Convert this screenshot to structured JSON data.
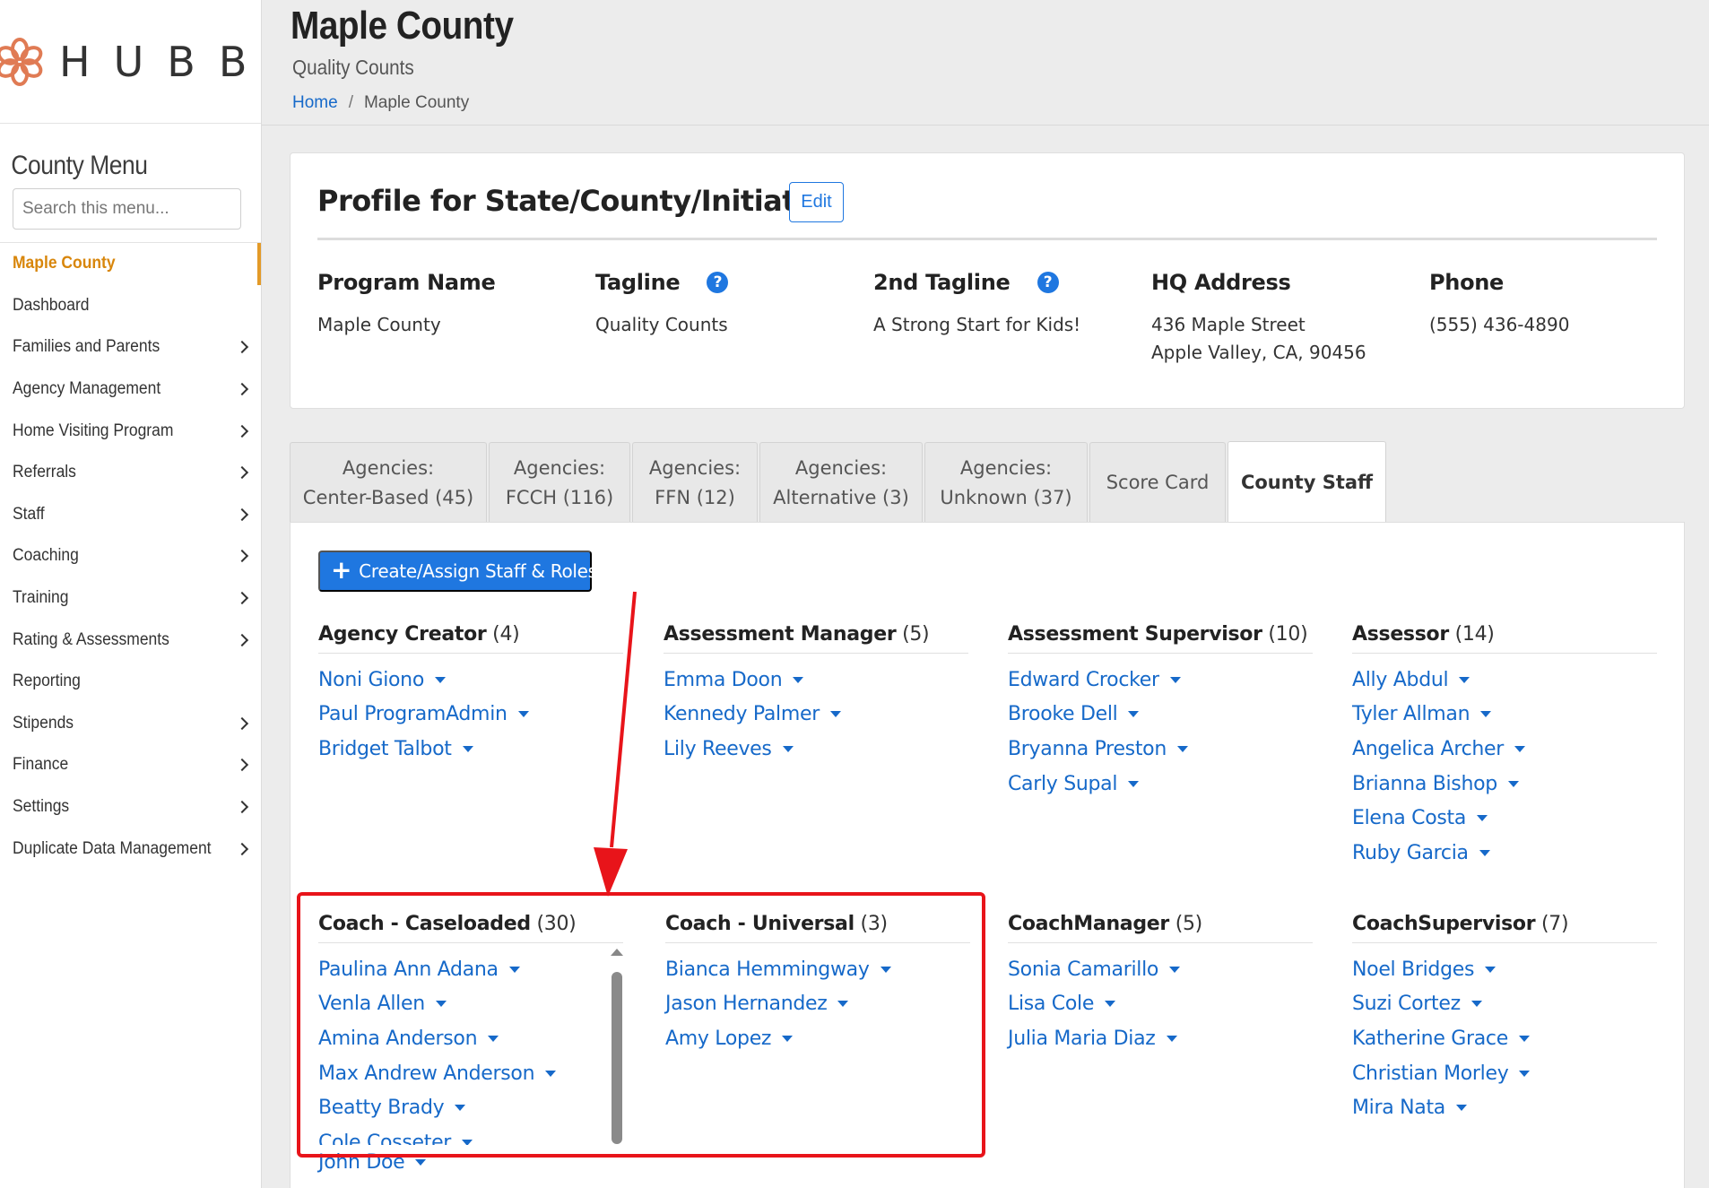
{
  "brand": {
    "name": "HUBBE",
    "accent": "#e07b54"
  },
  "sidebar": {
    "title": "County Menu",
    "search_placeholder": "Search this menu...",
    "items": [
      {
        "label": "Maple County",
        "active": true,
        "submenu": false
      },
      {
        "label": "Dashboard",
        "submenu": false
      },
      {
        "label": "Families and Parents",
        "submenu": true
      },
      {
        "label": "Agency Management",
        "submenu": true
      },
      {
        "label": "Home Visiting Program",
        "submenu": true
      },
      {
        "label": "Referrals",
        "submenu": true
      },
      {
        "label": "Staff",
        "submenu": true
      },
      {
        "label": "Coaching",
        "submenu": true
      },
      {
        "label": "Training",
        "submenu": true
      },
      {
        "label": "Rating & Assessments",
        "submenu": true
      },
      {
        "label": "Reporting",
        "submenu": false
      },
      {
        "label": "Stipends",
        "submenu": true
      },
      {
        "label": "Finance",
        "submenu": true
      },
      {
        "label": "Settings",
        "submenu": true
      },
      {
        "label": "Duplicate Data Management",
        "submenu": true
      }
    ]
  },
  "header": {
    "title": "Maple County",
    "subtitle": "Quality Counts",
    "breadcrumb": {
      "home": "Home",
      "separator": "/",
      "current": "Maple County"
    }
  },
  "profile": {
    "title": "Profile for State/County/Initiative",
    "edit_label": "Edit",
    "fields": [
      {
        "label": "Program Name",
        "value": "Maple County",
        "value2": ""
      },
      {
        "label": "Tagline",
        "value": "Quality Counts",
        "value2": "",
        "help": "?"
      },
      {
        "label": "2nd Tagline",
        "value": "A Strong Start for Kids!",
        "value2": "",
        "help": "?"
      },
      {
        "label": "HQ Address",
        "value": "436 Maple Street",
        "value2": "Apple Valley, CA, 90456"
      },
      {
        "label": "Phone",
        "value": "(555) 436-4890",
        "value2": ""
      }
    ]
  },
  "tabs": [
    {
      "line1": "Agencies:",
      "line2": "Center-Based (45)"
    },
    {
      "line1": "Agencies:",
      "line2": "FCCH (116)"
    },
    {
      "line1": "Agencies:",
      "line2": "FFN (12)"
    },
    {
      "line1": "Agencies:",
      "line2": "Alternative (3)"
    },
    {
      "line1": "Agencies:",
      "line2": "Unknown (37)"
    },
    {
      "line1": "Score Card",
      "line2": ""
    },
    {
      "line1": "County Staff",
      "line2": "",
      "active": true
    }
  ],
  "staff": {
    "create_button": "Create/Assign Staff & Roles",
    "roles": [
      {
        "name": "Agency Creator",
        "count": "(4)",
        "people": [
          "Noni Giono",
          "Paul ProgramAdmin",
          "Bridget Talbot"
        ]
      },
      {
        "name": "Assessment Manager",
        "count": "(5)",
        "people": [
          "Emma Doon",
          "Kennedy Palmer",
          "Lily Reeves"
        ]
      },
      {
        "name": "Assessment Supervisor",
        "count": "(10)",
        "people": [
          "Edward Crocker",
          "Brooke Dell",
          "Bryanna Preston",
          "Carly Supal"
        ]
      },
      {
        "name": "Assessor",
        "count": "(14)",
        "people": [
          "Ally Abdul",
          "Tyler Allman",
          "Angelica Archer",
          "Brianna Bishop",
          "Elena Costa",
          "Ruby Garcia"
        ]
      },
      {
        "name": "Coach - Caseloaded",
        "count": "(30)",
        "people": [
          "Paulina Ann Adana",
          "Venla Allen",
          "Amina Anderson",
          "Max Andrew Anderson",
          "Beatty Brady",
          "Cole Cosseter",
          "John Doe"
        ]
      },
      {
        "name": "Coach - Universal",
        "count": "(3)",
        "people": [
          "Bianca Hemmingway",
          "Jason Hernandez",
          "Amy Lopez"
        ]
      },
      {
        "name": "CoachManager",
        "count": "(5)",
        "people": [
          "Sonia Camarillo",
          "Lisa Cole",
          "Julia Maria Diaz"
        ]
      },
      {
        "name": "CoachSupervisor",
        "count": "(7)",
        "people": [
          "Noel Bridges",
          "Suzi Cortez",
          "Katherine Grace",
          "Christian Morley",
          "Mira Nata"
        ]
      }
    ]
  },
  "annotation_color": "#e8141a"
}
